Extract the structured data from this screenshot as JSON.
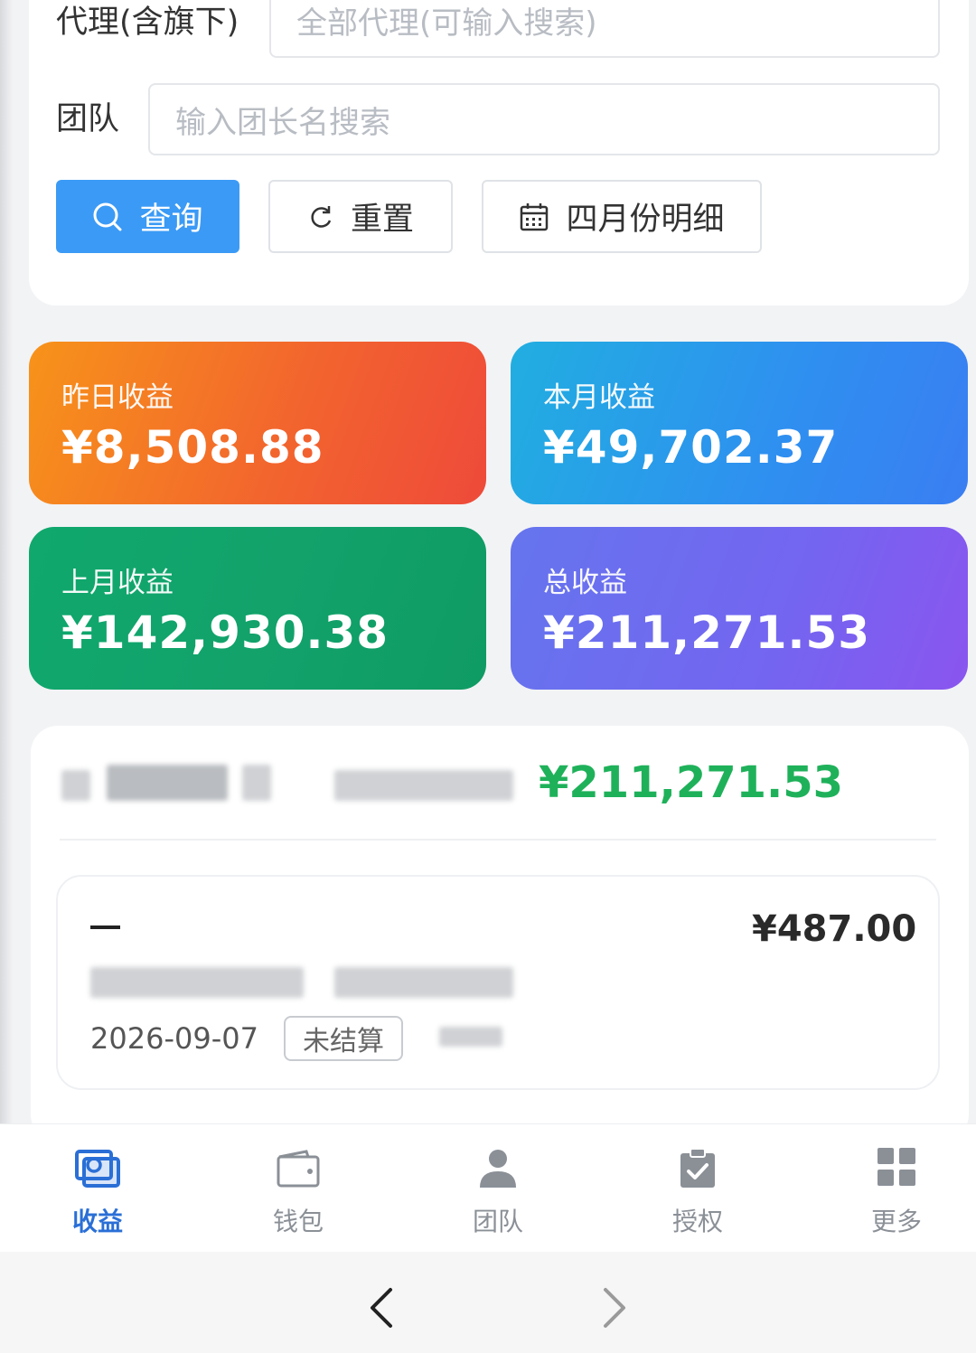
{
  "filter": {
    "agent_label": "代理(含旗下)",
    "agent_placeholder": "全部代理(可输入搜索)",
    "team_label": "团队",
    "team_placeholder": "输入团长名搜索",
    "query_button": "查询",
    "reset_button": "重置",
    "month_detail_button": "四月份明细"
  },
  "stats": {
    "yesterday": {
      "label": "昨日收益",
      "value": "¥8,508.88"
    },
    "this_month": {
      "label": "本月收益",
      "value": "¥49,702.37"
    },
    "last_month": {
      "label": "上月收益",
      "value": "¥142,930.38"
    },
    "total": {
      "label": "总收益",
      "value": "¥211,271.53"
    }
  },
  "summary": {
    "total_value": "¥211,271.53"
  },
  "record": {
    "dash": "—",
    "amount": "¥487.00",
    "date": "2026-09-07",
    "status": "未结算"
  },
  "tabbar": {
    "items": [
      {
        "label": "收益",
        "icon": "earnings-icon",
        "active": true
      },
      {
        "label": "钱包",
        "icon": "wallet-icon",
        "active": false
      },
      {
        "label": "团队",
        "icon": "team-icon",
        "active": false
      },
      {
        "label": "授权",
        "icon": "authorize-icon",
        "active": false
      },
      {
        "label": "更多",
        "icon": "more-icon",
        "active": false
      }
    ]
  },
  "colors": {
    "primary": "#3b9af5",
    "total_green": "#1fb15a",
    "tab_active": "#2a6fd6",
    "tab_inactive": "#8b9097"
  }
}
